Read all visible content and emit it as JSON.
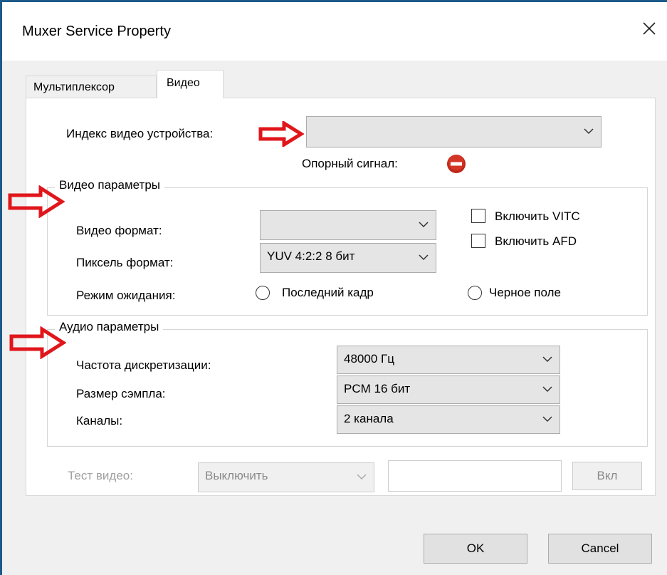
{
  "window": {
    "title": "Muxer Service Property"
  },
  "tabs": [
    {
      "label": "Мультиплексор",
      "active": false
    },
    {
      "label": "Видео",
      "active": true
    }
  ],
  "device": {
    "label": "Индекс видео устройства:",
    "value": "",
    "ref_signal_label": "Опорный сигнал:",
    "ref_signal_icon": "stop-icon",
    "ref_signal_color": "#c0271a"
  },
  "video_params": {
    "title": "Видео параметры",
    "format_label": "Видео формат:",
    "format_value": "",
    "pixel_label": "Пиксель формат:",
    "pixel_value": "YUV 4:2:2 8 бит",
    "standby_label": "Режим ожидания:",
    "radio_last_frame": "Последний кадр",
    "radio_black": "Черное поле",
    "vitc_label": "Включить VITC",
    "vitc_checked": false,
    "afd_label": "Включить AFD",
    "afd_checked": false
  },
  "audio_params": {
    "title": "Аудио параметры",
    "rate_label": "Частота дискретизации:",
    "rate_value": "48000 Гц",
    "sample_label": "Размер сэмпла:",
    "sample_value": "PCM 16 бит",
    "channels_label": "Каналы:",
    "channels_value": "2 канала"
  },
  "test_video": {
    "label": "Тест видео:",
    "value": "Выключить",
    "input_value": "",
    "button_label": "Вкл"
  },
  "buttons": {
    "ok": "OK",
    "cancel": "Cancel"
  },
  "colors": {
    "annotation_arrow": "#e0161b",
    "window_border": "#1c5a8a"
  }
}
